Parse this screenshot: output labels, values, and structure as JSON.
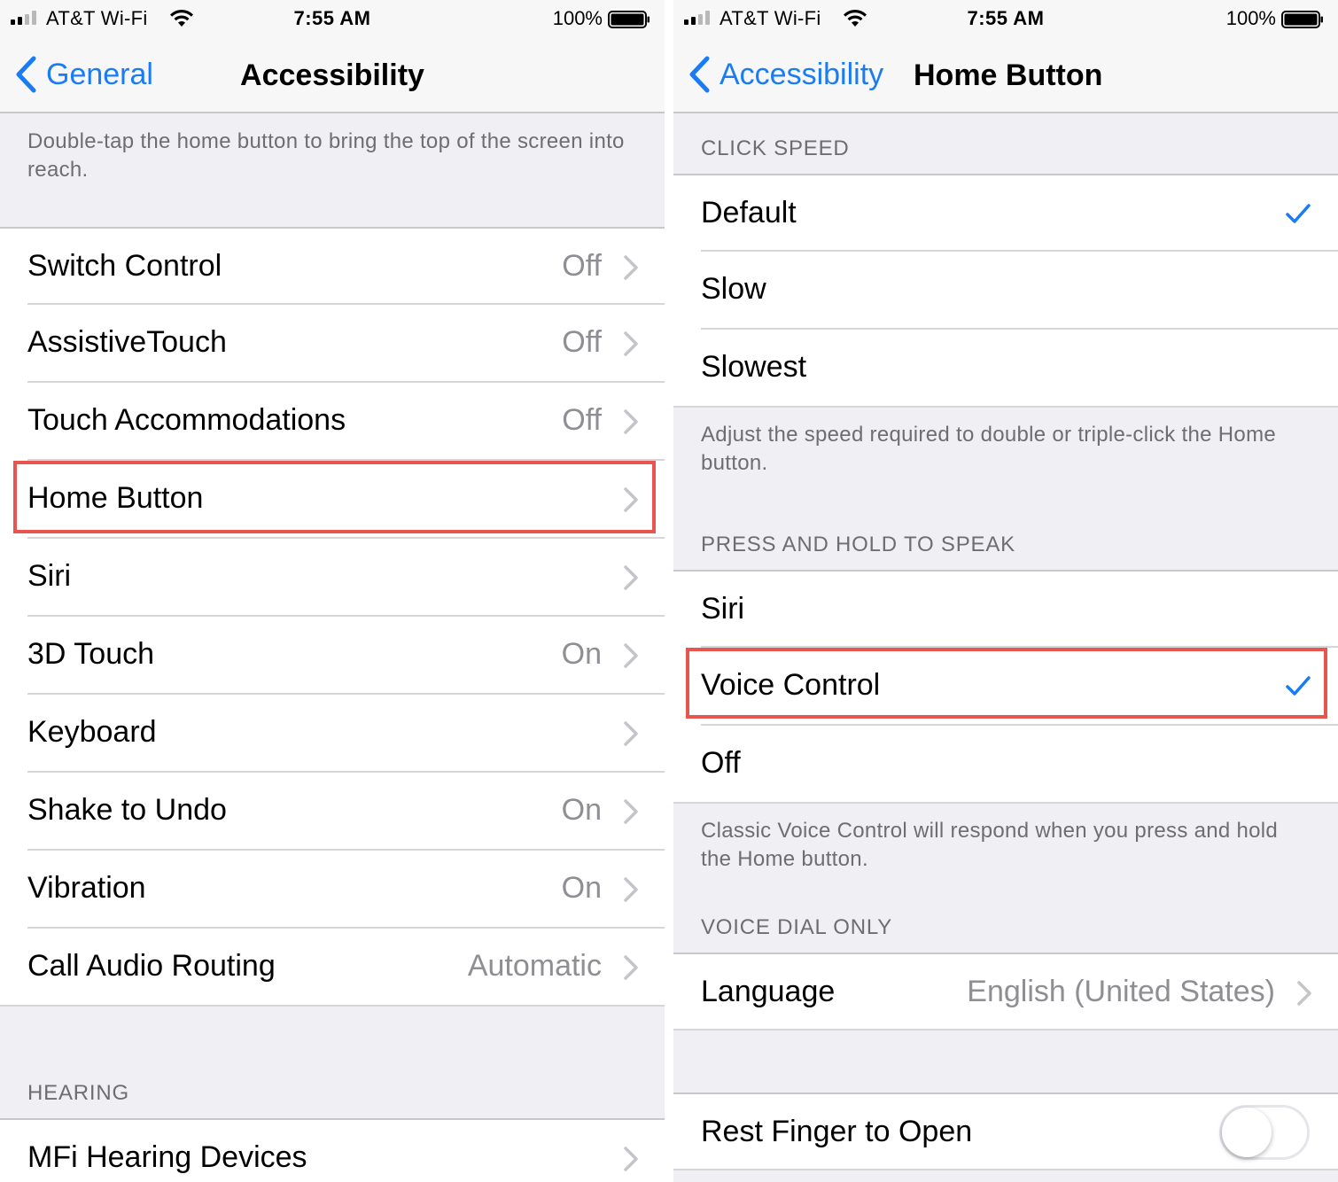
{
  "status_bar": {
    "carrier": "AT&T Wi-Fi",
    "time": "7:55 AM",
    "battery": "100%"
  },
  "left": {
    "nav": {
      "back_label": "General",
      "title": "Accessibility"
    },
    "top_note": "Double-tap the home button to bring the top of the screen into reach.",
    "items": [
      {
        "label": "Switch Control",
        "value": "Off"
      },
      {
        "label": "AssistiveTouch",
        "value": "Off"
      },
      {
        "label": "Touch Accommodations",
        "value": "Off"
      },
      {
        "label": "Home Button",
        "value": ""
      },
      {
        "label": "Siri",
        "value": ""
      },
      {
        "label": "3D Touch",
        "value": "On"
      },
      {
        "label": "Keyboard",
        "value": ""
      },
      {
        "label": "Shake to Undo",
        "value": "On"
      },
      {
        "label": "Vibration",
        "value": "On"
      },
      {
        "label": "Call Audio Routing",
        "value": "Automatic"
      }
    ],
    "hearing_header": "HEARING",
    "hearing_items": [
      {
        "label": "MFi Hearing Devices"
      }
    ]
  },
  "right": {
    "nav": {
      "back_label": "Accessibility",
      "title": "Home Button"
    },
    "click_speed_header": "CLICK SPEED",
    "click_speed_options": [
      {
        "label": "Default",
        "selected": true
      },
      {
        "label": "Slow",
        "selected": false
      },
      {
        "label": "Slowest",
        "selected": false
      }
    ],
    "click_speed_note": "Adjust the speed required to double or triple-click the Home button.",
    "press_hold_header": "PRESS AND HOLD TO SPEAK",
    "press_hold_options": [
      {
        "label": "Siri",
        "selected": false
      },
      {
        "label": "Voice Control",
        "selected": true
      },
      {
        "label": "Off",
        "selected": false
      }
    ],
    "press_hold_note": "Classic Voice Control will respond when you press and hold the Home button.",
    "voice_dial_header": "VOICE DIAL ONLY",
    "language": {
      "label": "Language",
      "value": "English (United States)"
    },
    "rest_finger": {
      "label": "Rest Finger to Open",
      "on": false
    }
  },
  "colors": {
    "accent": "#1a7cf5",
    "highlight": "#e8554e",
    "background": "#efeff4"
  }
}
